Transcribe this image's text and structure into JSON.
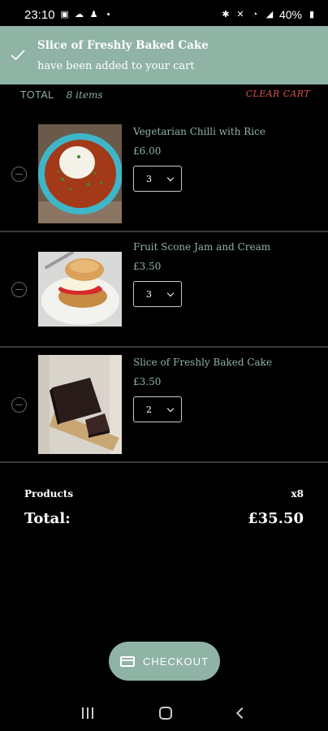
{
  "status_bar": {
    "time": "23:10",
    "battery": "40%"
  },
  "toast": {
    "title": "Slice of Freshly Baked Cake",
    "message": "have been added to your cart"
  },
  "cart_header": {
    "total_label": "TOTAL",
    "item_count": "8 items",
    "clear_label": "CLEAR CART"
  },
  "items": [
    {
      "name": "Vegetarian Chilli with Rice",
      "price": "£6.00",
      "quantity": "3"
    },
    {
      "name": "Fruit Scone Jam and Cream",
      "price": "£3.50",
      "quantity": "3"
    },
    {
      "name": "Slice of Freshly Baked Cake",
      "price": "£3.50",
      "quantity": "2"
    }
  ],
  "summary": {
    "products_label": "Products",
    "products_count": "x8",
    "total_label": "Total:",
    "total_value": "£35.50"
  },
  "checkout": {
    "label": "CHECKOUT"
  },
  "colors": {
    "accent": "#8fb3a5",
    "danger": "#d9534f",
    "background": "#000000"
  }
}
